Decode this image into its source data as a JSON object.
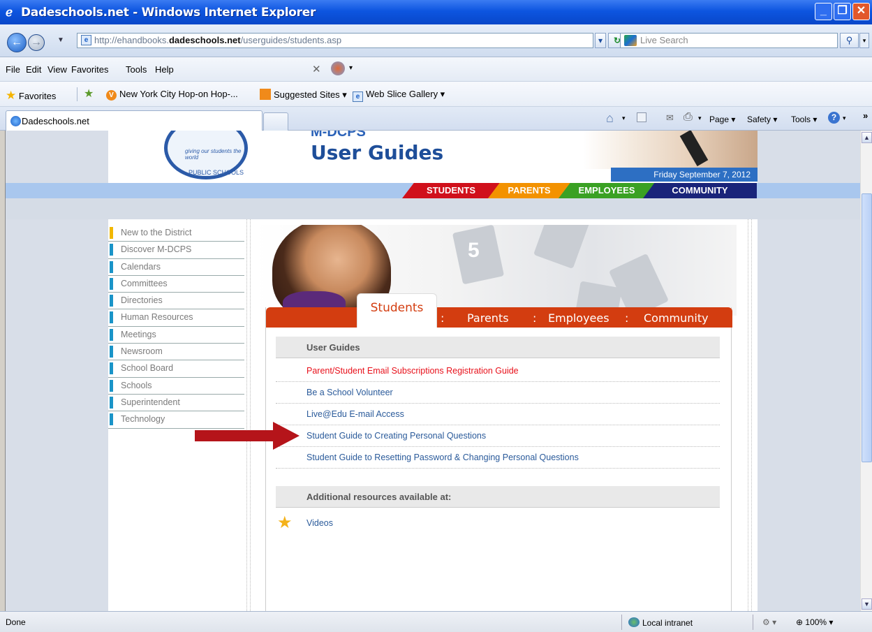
{
  "window": {
    "title": "Dadeschools.net - Windows Internet Explorer"
  },
  "address_bar": {
    "url_prefix": "http://ehandbooks.",
    "url_domain": "dadeschools.net",
    "url_path": "/userguides/students.asp",
    "search_placeholder": "Live Search"
  },
  "menu": {
    "items": [
      "File",
      "Edit",
      "View",
      "Favorites",
      "Tools",
      "Help"
    ]
  },
  "favorites_bar": {
    "favorites_label": "Favorites",
    "items": [
      "New York City Hop-on Hop-...",
      "Suggested Sites ▾",
      "Web Slice Gallery ▾"
    ]
  },
  "tabs": {
    "active_tab": "Dadeschools.net"
  },
  "command_bar": {
    "page": "Page ▾",
    "safety": "Safety ▾",
    "tools": "Tools ▾"
  },
  "header": {
    "brand_top": "M-DCPS",
    "brand": "User Guides",
    "date": "Friday September 7, 2012",
    "logo_text_1": "giving our students the world",
    "logo_text_2": "PUBLIC SCHOOLS",
    "nav": [
      "STUDENTS",
      "PARENTS",
      "EMPLOYEES",
      "COMMUNITY"
    ]
  },
  "sidebar": {
    "items": [
      "New to the District",
      "Discover M-DCPS",
      "Calendars",
      "Committees",
      "Directories",
      "Human Resources",
      "Meetings",
      "Newsroom",
      "School Board",
      "Schools",
      "Superintendent",
      "Technology"
    ]
  },
  "hero": {
    "number": "5"
  },
  "guides": {
    "tabs": [
      "Students",
      "Parents",
      "Employees",
      "Community"
    ],
    "separator": ":",
    "section_title": "User Guides",
    "links": [
      "Parent/Student Email Subscriptions Registration Guide",
      "Be a School Volunteer",
      "Live@Edu E-mail Access",
      "Student Guide to Creating Personal Questions",
      "Student Guide to Resetting Password & Changing Personal Questions"
    ],
    "additional_title": "Additional resources available at:",
    "videos": "Videos"
  },
  "status_bar": {
    "status": "Done",
    "zone": "Local intranet",
    "zoom": "100%"
  }
}
